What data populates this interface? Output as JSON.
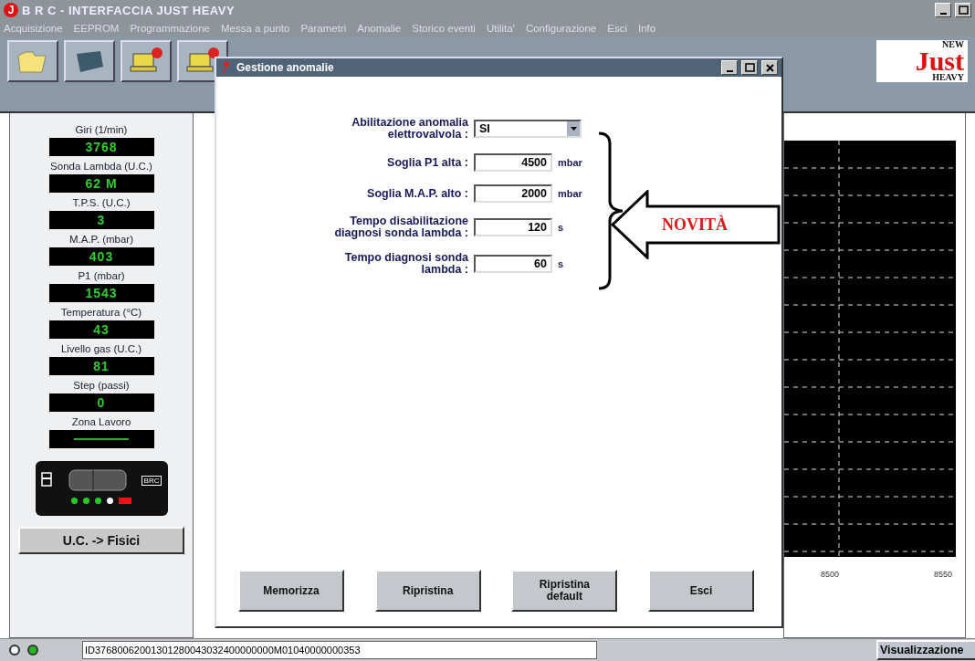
{
  "window": {
    "icon_letter": "J",
    "title": "B R C - INTERFACCIA JUST HEAVY"
  },
  "menu": [
    "Acquisizione",
    "EEPROM",
    "Programmazione",
    "Messa a punto",
    "Parametri",
    "Anomalie",
    "Storico eventi",
    "Utilita'",
    "Configurazione",
    "Esci",
    "Info"
  ],
  "logo": {
    "top": "NEW",
    "main": "Just",
    "bottom": "HEAVY"
  },
  "gauges": [
    {
      "kind": "number",
      "label": "Giri (1/min)",
      "value": "3768"
    },
    {
      "kind": "number",
      "label": "Sonda Lambda (U.C.)",
      "value": "62 M"
    },
    {
      "kind": "number",
      "label": "T.P.S. (U.C.)",
      "value": "3"
    },
    {
      "kind": "number",
      "label": "M.A.P. (mbar)",
      "value": "403"
    },
    {
      "kind": "number",
      "label": "P1 (mbar)",
      "value": "1543"
    },
    {
      "kind": "number",
      "label": "Temperatura (°C)",
      "value": "43"
    },
    {
      "kind": "number",
      "label": "Livello gas (U.C.)",
      "value": "81"
    },
    {
      "kind": "number",
      "label": "Step (passi)",
      "value": "0"
    },
    {
      "kind": "line",
      "label": "Zona Lavoro"
    }
  ],
  "device": {
    "badge": "BRC",
    "leds": [
      {
        "color": "#22cc22"
      },
      {
        "color": "#22cc22"
      },
      {
        "color": "#22cc22"
      },
      {
        "color": "#ffffff"
      },
      {
        "color": "#ee1111"
      }
    ]
  },
  "convert_button": "U.C. -> Fisici",
  "chart_axis_labels": [
    "8500",
    "8550"
  ],
  "dialog": {
    "title": "Gestione anomalie",
    "fields": [
      {
        "kind": "select",
        "label": "Abilitazione anomalia elettrovalvola :",
        "value": "SI"
      },
      {
        "kind": "input",
        "label": "Soglia P1 alta :",
        "value": "4500",
        "unit": "mbar"
      },
      {
        "kind": "input",
        "label": "Soglia M.A.P. alto :",
        "value": "2000",
        "unit": "mbar"
      },
      {
        "kind": "input",
        "label": "Tempo disabilitazione diagnosi sonda lambda :",
        "value": "120",
        "unit": "s"
      },
      {
        "kind": "input",
        "label": "Tempo diagnosi sonda lambda :",
        "value": "60",
        "unit": "s"
      }
    ],
    "callout": "NOVITÀ",
    "buttons": [
      "Memorizza",
      "Ripristina",
      "Ripristina default",
      "Esci"
    ]
  },
  "status_bar": {
    "lights": [
      {
        "color": "#ffffff"
      },
      {
        "color": "#22bb22"
      }
    ],
    "message": "ID37680062001301280043032400000000M01040000000353",
    "button": "Visualizzazione"
  }
}
